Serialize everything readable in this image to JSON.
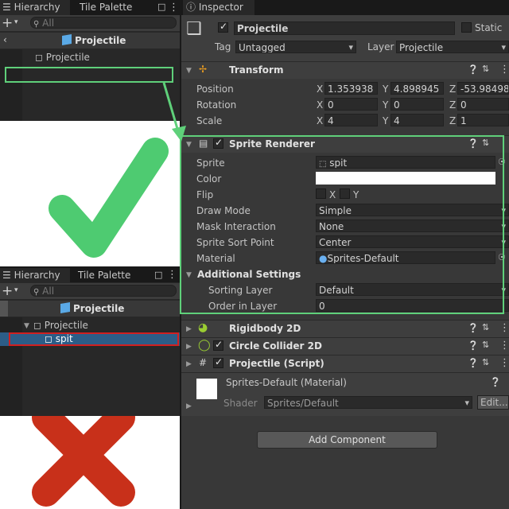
{
  "left_top": {
    "tabs": {
      "hierarchy": "Hierarchy",
      "tile_palette": "Tile Palette"
    },
    "search_placeholder": "All",
    "scene_title": "Projectile",
    "items": [
      "Projectile"
    ]
  },
  "left_bottom": {
    "tabs": {
      "hierarchy": "Hierarchy",
      "tile_palette": "Tile Palette"
    },
    "search_placeholder": "All",
    "scene_title": "Projectile",
    "items": [
      "Projectile",
      "spit"
    ]
  },
  "inspector": {
    "tab": "Inspector",
    "object_name": "Projectile",
    "static_label": "Static",
    "tag_label": "Tag",
    "tag_value": "Untagged",
    "layer_label": "Layer",
    "layer_value": "Projectile",
    "transform": {
      "title": "Transform",
      "position_label": "Position",
      "rotation_label": "Rotation",
      "scale_label": "Scale",
      "axis_x": "X",
      "axis_y": "Y",
      "axis_z": "Z",
      "position": [
        "1.353938",
        "4.898945",
        "-53.98498"
      ],
      "rotation": [
        "0",
        "0",
        "0"
      ],
      "scale": [
        "4",
        "4",
        "1"
      ]
    },
    "sprite_renderer": {
      "title": "Sprite Renderer",
      "sprite_label": "Sprite",
      "sprite_value": "spit",
      "color_label": "Color",
      "flip_label": "Flip",
      "flip_x": "X",
      "flip_y": "Y",
      "draw_mode_label": "Draw Mode",
      "draw_mode_value": "Simple",
      "mask_label": "Mask Interaction",
      "mask_value": "None",
      "sort_point_label": "Sprite Sort Point",
      "sort_point_value": "Center",
      "material_label": "Material",
      "material_value": "Sprites-Default",
      "additional_label": "Additional Settings",
      "sorting_layer_label": "Sorting Layer",
      "sorting_layer_value": "Default",
      "order_label": "Order in Layer",
      "order_value": "0"
    },
    "components": [
      "Rigidbody 2D",
      "Circle Collider 2D",
      "Projectile (Script)"
    ],
    "material_section": {
      "title": "Sprites-Default (Material)",
      "shader_label": "Shader",
      "shader_value": "Sprites/Default",
      "edit_label": "Edit..."
    },
    "add_component": "Add Component"
  },
  "colors": {
    "green_check": "#4ecb71",
    "red_cross": "#c8301a",
    "highlight_green": "#5fd07a",
    "highlight_red": "#d02020",
    "selection": "#2c5d87"
  }
}
